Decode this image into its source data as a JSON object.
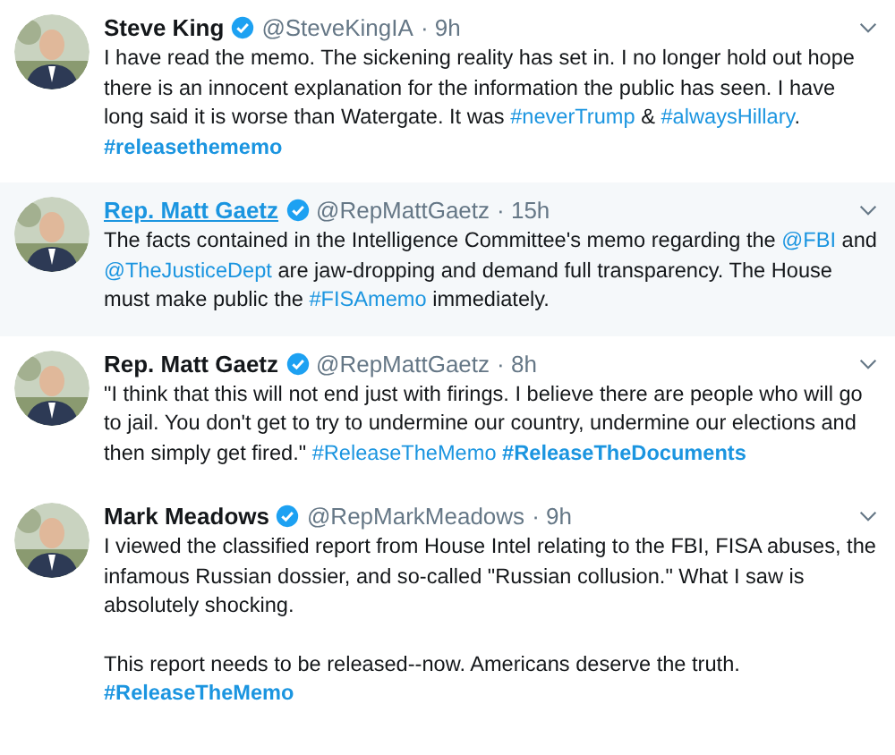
{
  "tweets": [
    {
      "name": "Steve King",
      "handle": "@SteveKingIA",
      "time": "· 9h",
      "verified": true,
      "highlighted": false,
      "body": [
        [
          {
            "kind": "text",
            "text": "I have read the memo. The sickening reality has set in. I no longer hold out hope there is an innocent explanation for the information the public has seen. I have long said it is worse than Watergate. It was "
          },
          {
            "kind": "link",
            "text": "#neverTrump",
            "bold": false
          },
          {
            "kind": "text",
            "text": " & "
          },
          {
            "kind": "link",
            "text": "#alwaysHillary",
            "bold": false
          },
          {
            "kind": "text",
            "text": ". "
          },
          {
            "kind": "link",
            "text": "#releasethememo",
            "bold": true
          }
        ]
      ]
    },
    {
      "name": "Rep. Matt Gaetz",
      "handle": "@RepMattGaetz",
      "time": "· 15h",
      "verified": true,
      "highlighted": true,
      "body": [
        [
          {
            "kind": "text",
            "text": "The facts contained in the Intelligence Committee's memo regarding the "
          },
          {
            "kind": "link",
            "text": "@FBI",
            "bold": false
          },
          {
            "kind": "text",
            "text": " and "
          },
          {
            "kind": "link",
            "text": "@TheJusticeDept",
            "bold": false
          },
          {
            "kind": "text",
            "text": " are jaw-dropping and demand full transparency. The House must make public the "
          },
          {
            "kind": "link",
            "text": "#FISAmemo",
            "bold": false
          },
          {
            "kind": "text",
            "text": " immediately."
          }
        ]
      ]
    },
    {
      "name": "Rep. Matt Gaetz",
      "handle": "@RepMattGaetz",
      "time": "· 8h",
      "verified": true,
      "highlighted": false,
      "body": [
        [
          {
            "kind": "text",
            "text": "\"I think that this will not end just with firings. I believe there are people who will go to jail. You don't get to try to undermine our country, undermine our elections and then simply get fired.\" "
          },
          {
            "kind": "link",
            "text": "#ReleaseTheMemo",
            "bold": false
          },
          {
            "kind": "link",
            "text": "#ReleaseTheDocuments",
            "bold": true
          }
        ]
      ]
    },
    {
      "name": "Mark Meadows",
      "handle": "@RepMarkMeadows",
      "time": "· 9h",
      "verified": true,
      "highlighted": false,
      "body": [
        [
          {
            "kind": "text",
            "text": "I viewed the classified report from House Intel relating to the FBI, FISA abuses, the infamous Russian dossier, and so-called \"Russian collusion.\" What I saw is absolutely shocking."
          }
        ],
        [
          {
            "kind": "text",
            "text": "This report needs to be released--now. Americans deserve the truth. "
          },
          {
            "kind": "link",
            "text": "#ReleaseTheMemo",
            "bold": true
          }
        ]
      ]
    }
  ]
}
